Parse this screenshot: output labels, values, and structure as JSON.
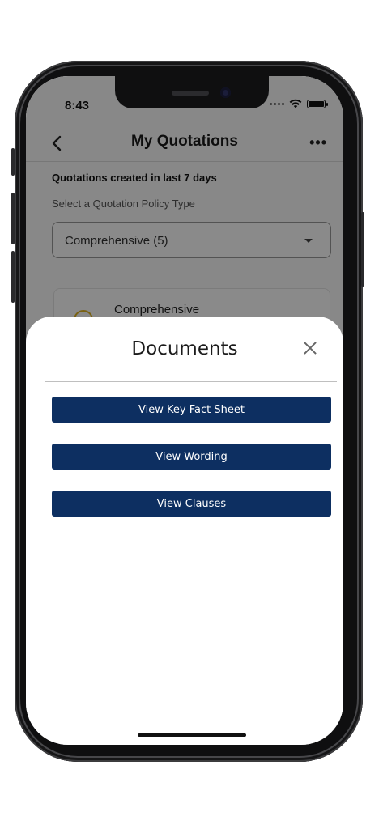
{
  "status_bar": {
    "time": "8:43"
  },
  "nav": {
    "title": "My Quotations"
  },
  "page": {
    "section_title": "Quotations created in last 7 days",
    "section_subtitle": "Select a Quotation Policy Type",
    "policy_type_selected": "Comprehensive (5)",
    "card_title": "Comprehensive"
  },
  "sheet": {
    "title": "Documents",
    "buttons": [
      "View Key Fact Sheet",
      "View Wording",
      "View Clauses"
    ]
  },
  "colors": {
    "primary_button": "#0d2f61",
    "card_accent": "#e0b321"
  }
}
